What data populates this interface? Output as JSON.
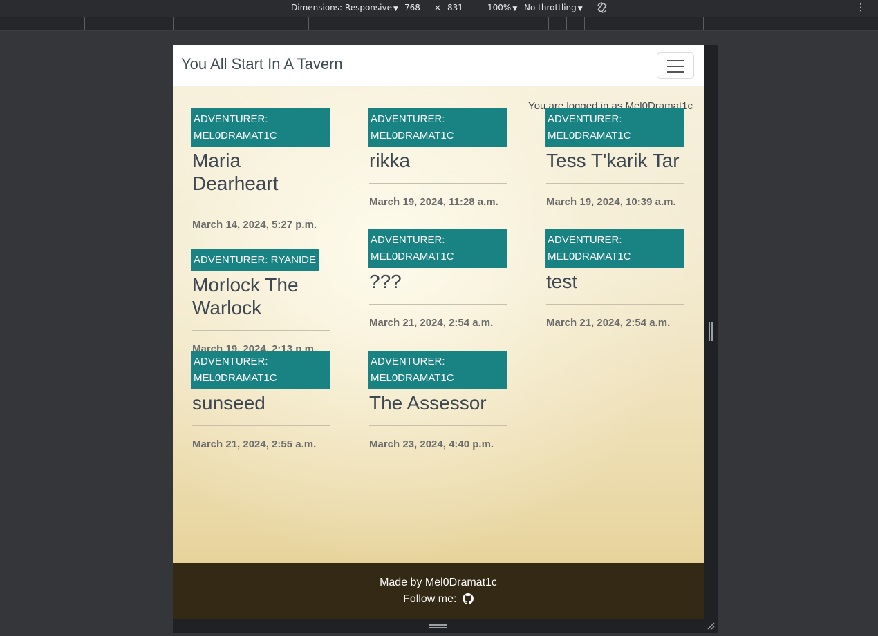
{
  "devtools": {
    "dimensions_label": "Dimensions: Responsive",
    "width": "768",
    "times": "×",
    "height": "831",
    "zoom": "100%",
    "throttling": "No throttling",
    "rotate_icon": "rotate-icon",
    "more_icon": "more-vertical-icon"
  },
  "site": {
    "brand": "You All Start In A Tavern",
    "menu_icon": "hamburger-menu-icon",
    "logged_in": "You are logged in as Mel0Dramat1c"
  },
  "cards": [
    {
      "adventurer": "ADVENTURER: MEL0DRAMAT1C",
      "title": "Maria Dearheart",
      "date": "March 14, 2024, 5:27 p.m."
    },
    {
      "adventurer": "ADVENTURER: MEL0DRAMAT1C",
      "title": "rikka",
      "date": "March 19, 2024, 11:28 a.m."
    },
    {
      "adventurer": "ADVENTURER: MEL0DRAMAT1C",
      "title": "Tess T'karik Tar",
      "date": "March 19, 2024, 10:39 a.m."
    },
    {
      "adventurer": "ADVENTURER: RYANIDE",
      "title": "Morlock The Warlock",
      "date": "March 19, 2024, 2:13 p.m."
    },
    {
      "adventurer": "ADVENTURER: MEL0DRAMAT1C",
      "title": "???",
      "date": "March 21, 2024, 2:54 a.m."
    },
    {
      "adventurer": "ADVENTURER: MEL0DRAMAT1C",
      "title": "test",
      "date": "March 21, 2024, 2:54 a.m."
    },
    {
      "adventurer": "ADVENTURER: MEL0DRAMAT1C",
      "title": "sunseed",
      "date": "March 21, 2024, 2:55 a.m."
    },
    {
      "adventurer": "ADVENTURER: MEL0DRAMAT1C",
      "title": "The Assessor",
      "date": "March 23, 2024, 4:40 p.m."
    }
  ],
  "footer": {
    "made_by": "Made by Mel0Dramat1c",
    "follow": "Follow me:",
    "github_icon": "github-icon"
  },
  "colors": {
    "badge": "#198383",
    "footer": "#342914",
    "text": "#3d4753"
  }
}
